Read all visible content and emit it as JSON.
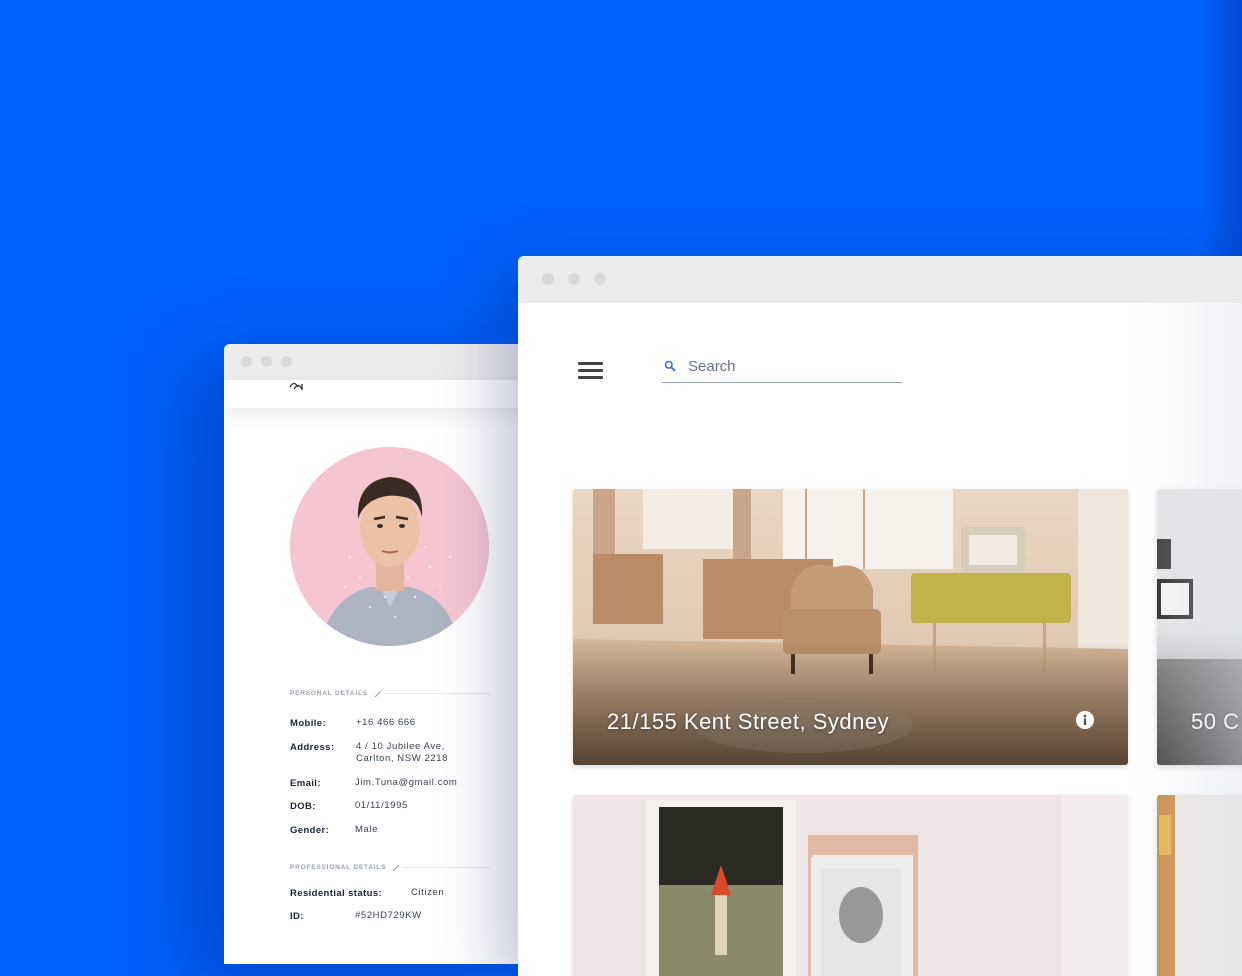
{
  "profile_window": {
    "personal_section_title": "PERSONAL DETAILS",
    "personal_fields": [
      {
        "label": "Mobile:",
        "value": "+16 466 666"
      },
      {
        "label": "Address:",
        "value": "4 / 10 Jubilee Ave,",
        "value2": "Carlton, NSW 2218"
      },
      {
        "label": "Email:",
        "value": "Jim.Tuna@gmail.com"
      },
      {
        "label": "DOB:",
        "value": "01/11/1995"
      },
      {
        "label": "Gender:",
        "value": "Male"
      }
    ],
    "professional_section_title": "PROFESSIONAL DETAILS",
    "professional_fields": [
      {
        "label": "Residential status:",
        "value": "Citizen"
      },
      {
        "label": "ID:",
        "value": "#52HD729KW"
      }
    ]
  },
  "main_window": {
    "search": {
      "placeholder": "Search",
      "value": ""
    },
    "listings": [
      {
        "title": "21/155 Kent Street, Sydney"
      },
      {
        "title": "50 C"
      }
    ]
  },
  "colors": {
    "background": "#0061fb",
    "titlebar": "#ececec",
    "text_dark": "#1c2433"
  },
  "icons": [
    "menu-icon",
    "search-icon",
    "info-icon",
    "pencil-icon",
    "window-dot-icon"
  ]
}
